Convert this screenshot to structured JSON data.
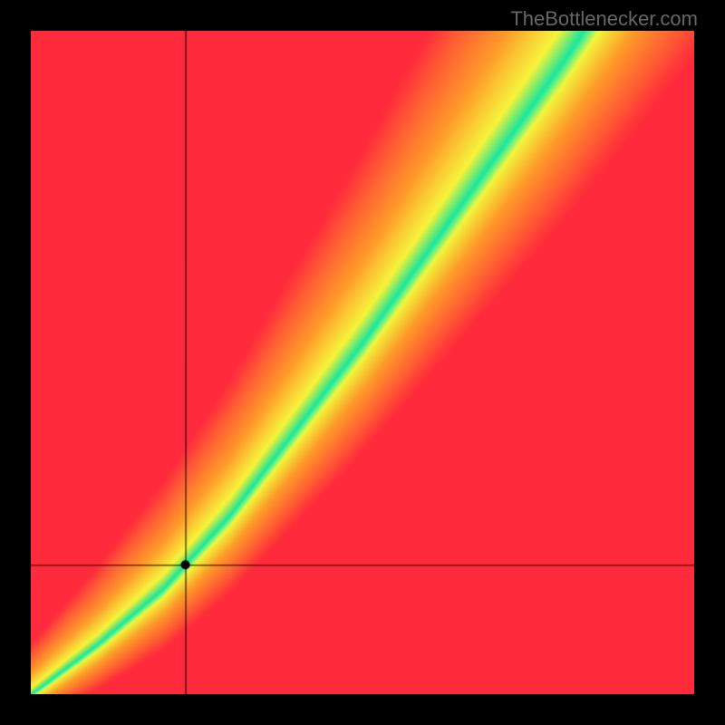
{
  "watermark": "TheBottlenecker.com",
  "chart_data": {
    "type": "heatmap",
    "title": "",
    "xlabel": "",
    "ylabel": "",
    "x_range": [
      0,
      1
    ],
    "y_range": [
      0,
      1
    ],
    "marker": {
      "x": 0.233,
      "y": 0.195
    },
    "crosshair": {
      "x": 0.233,
      "y": 0.195
    },
    "optimal_ratio_curve": {
      "description": "Green band where GPU/CPU ratio is optimal; deviates toward red as imbalance grows",
      "points_x": [
        0.0,
        0.1,
        0.2,
        0.3,
        0.4,
        0.5,
        0.6,
        0.7,
        0.8,
        0.9,
        1.0
      ],
      "points_y_center": [
        0.0,
        0.075,
        0.16,
        0.27,
        0.4,
        0.53,
        0.67,
        0.81,
        0.95,
        1.1,
        1.25
      ]
    },
    "colors": {
      "optimal": "#18E8A0",
      "near": "#F5F53C",
      "mid": "#FF9B2A",
      "far": "#FF2A3C"
    }
  }
}
